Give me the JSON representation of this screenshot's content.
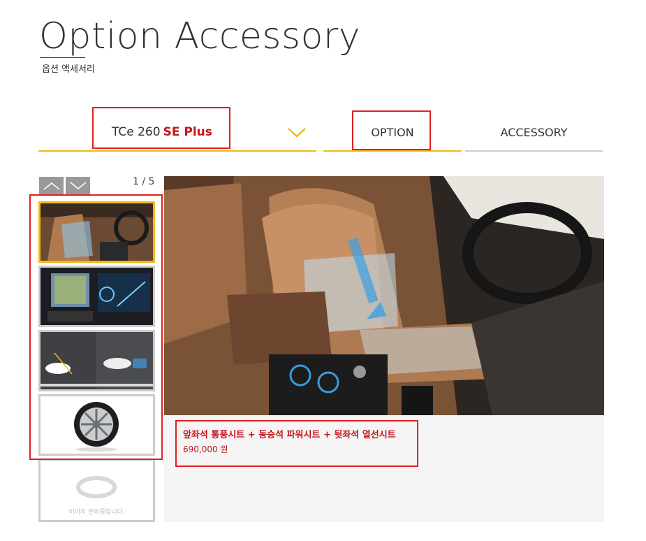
{
  "header": {
    "title": "Option Accessory",
    "subtitle": "옵션 액세서리"
  },
  "model_select": {
    "base": "TCe 260",
    "trim": "SE Plus"
  },
  "tabs": [
    {
      "label": "OPTION"
    },
    {
      "label": "ACCESSORY"
    }
  ],
  "gallery": {
    "counter": "1 / 5",
    "placeholder_text": "이미지 준비중입니다.",
    "caption": {
      "title": "앞좌석 통풍시트 + 동승석 파워시트 + 뒷좌석 열선시트",
      "price": "690,000 원"
    }
  },
  "colors": {
    "accent": "#f5b916",
    "brand_red": "#c4161c",
    "highlight_box": "#e02020"
  }
}
